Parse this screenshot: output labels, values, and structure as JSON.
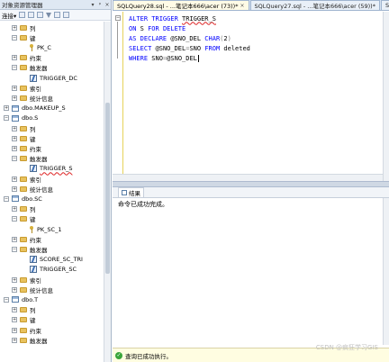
{
  "explorer": {
    "title": "对象资源管理器",
    "pin_glyph": "▾",
    "autohide_glyph": "ᵖ",
    "close_glyph": "×",
    "toolbar": {
      "connect_label": "连接",
      "connect_caret": "▾"
    },
    "expand_glyph": "+",
    "collapse_glyph": "−",
    "tree": [
      {
        "label": "列",
        "icon": "folder",
        "exp": "+",
        "level": 2
      },
      {
        "label": "键",
        "icon": "folder",
        "exp": "−",
        "level": 2
      },
      {
        "label": "PK_C",
        "icon": "key",
        "exp": "",
        "level": 3
      },
      {
        "label": "约束",
        "icon": "folder",
        "exp": "+",
        "level": 2
      },
      {
        "label": "触发器",
        "icon": "folder",
        "exp": "−",
        "level": 2
      },
      {
        "label": "TRIGGER_DC",
        "icon": "trigger",
        "exp": "",
        "level": 3
      },
      {
        "label": "索引",
        "icon": "folder",
        "exp": "+",
        "level": 2
      },
      {
        "label": "统计信息",
        "icon": "folder",
        "exp": "+",
        "level": 2
      },
      {
        "label": "dbo.MAKEUP_S",
        "icon": "table",
        "exp": "+",
        "level": 1
      },
      {
        "label": "dbo.S",
        "icon": "table",
        "exp": "−",
        "level": 1
      },
      {
        "label": "列",
        "icon": "folder",
        "exp": "+",
        "level": 2
      },
      {
        "label": "键",
        "icon": "folder",
        "exp": "+",
        "level": 2
      },
      {
        "label": "约束",
        "icon": "folder",
        "exp": "+",
        "level": 2
      },
      {
        "label": "触发器",
        "icon": "folder",
        "exp": "−",
        "level": 2
      },
      {
        "label": "TRIGGER_S",
        "icon": "trigger",
        "exp": "",
        "level": 3,
        "underline": true
      },
      {
        "label": "索引",
        "icon": "folder",
        "exp": "+",
        "level": 2
      },
      {
        "label": "统计信息",
        "icon": "folder",
        "exp": "+",
        "level": 2
      },
      {
        "label": "dbo.SC",
        "icon": "table",
        "exp": "−",
        "level": 1
      },
      {
        "label": "列",
        "icon": "folder",
        "exp": "+",
        "level": 2
      },
      {
        "label": "键",
        "icon": "folder",
        "exp": "−",
        "level": 2
      },
      {
        "label": "PK_SC_1",
        "icon": "key",
        "exp": "",
        "level": 3
      },
      {
        "label": "约束",
        "icon": "folder",
        "exp": "+",
        "level": 2
      },
      {
        "label": "触发器",
        "icon": "folder",
        "exp": "−",
        "level": 2
      },
      {
        "label": "SCORE_SC_TRI",
        "icon": "trigger",
        "exp": "",
        "level": 3
      },
      {
        "label": "TRIGGER_SC",
        "icon": "trigger",
        "exp": "",
        "level": 3
      },
      {
        "label": "索引",
        "icon": "folder",
        "exp": "+",
        "level": 2
      },
      {
        "label": "统计信息",
        "icon": "folder",
        "exp": "+",
        "level": 2
      },
      {
        "label": "dbo.T",
        "icon": "table",
        "exp": "−",
        "level": 1
      },
      {
        "label": "列",
        "icon": "folder",
        "exp": "+",
        "level": 2
      },
      {
        "label": "键",
        "icon": "folder",
        "exp": "+",
        "level": 2
      },
      {
        "label": "约束",
        "icon": "folder",
        "exp": "+",
        "level": 2
      },
      {
        "label": "触发器",
        "icon": "folder",
        "exp": "+",
        "level": 2
      }
    ]
  },
  "tabs": [
    {
      "label": "SQLQuery28.sql - ...笔记本666\\acer (73))*",
      "close": "×",
      "active": true
    },
    {
      "label": "SQLQuery27.sql - ...笔记本666\\acer (59))*",
      "close": "",
      "active": false
    },
    {
      "label": "SQLQuery26.sql -",
      "close": "",
      "active": false
    }
  ],
  "editor": {
    "collapse_glyph": "−",
    "lines": [
      [
        {
          "t": "ALTER TRIGGER ",
          "c": "kw"
        },
        {
          "t": "TRIGGER_S",
          "c": "tx",
          "ul": true
        }
      ],
      [
        {
          "t": "ON ",
          "c": "kw"
        },
        {
          "t": "S ",
          "c": "tx"
        },
        {
          "t": "FOR DELETE",
          "c": "kw"
        }
      ],
      [
        {
          "t": "AS DECLARE ",
          "c": "kw"
        },
        {
          "t": "@SNO_DEL ",
          "c": "tx"
        },
        {
          "t": "CHAR",
          "c": "kw"
        },
        {
          "t": "(",
          "c": "gr"
        },
        {
          "t": "2",
          "c": "tx"
        },
        {
          "t": ")",
          "c": "gr"
        }
      ],
      [
        {
          "t": "SELECT ",
          "c": "kw"
        },
        {
          "t": "@SNO_DEL",
          "c": "tx"
        },
        {
          "t": "=",
          "c": "gr"
        },
        {
          "t": "SNO ",
          "c": "tx"
        },
        {
          "t": "FROM ",
          "c": "kw"
        },
        {
          "t": "deleted",
          "c": "tx"
        }
      ],
      [
        {
          "t": "WHERE ",
          "c": "kw"
        },
        {
          "t": "SNO",
          "c": "tx"
        },
        {
          "t": "=",
          "c": "gr"
        },
        {
          "t": "@SNO_DEL",
          "c": "tx"
        }
      ]
    ]
  },
  "results": {
    "tab_label": "结果",
    "message": "命令已成功完成。"
  },
  "status": {
    "text": "查询已成功执行。",
    "ok_glyph": "✓"
  },
  "watermark": "CSDN @疯狂学习GIS",
  "colors": {
    "keyword": "#0000ff",
    "error_underline": "#dd2222",
    "status_ok": "#3aa53a"
  }
}
